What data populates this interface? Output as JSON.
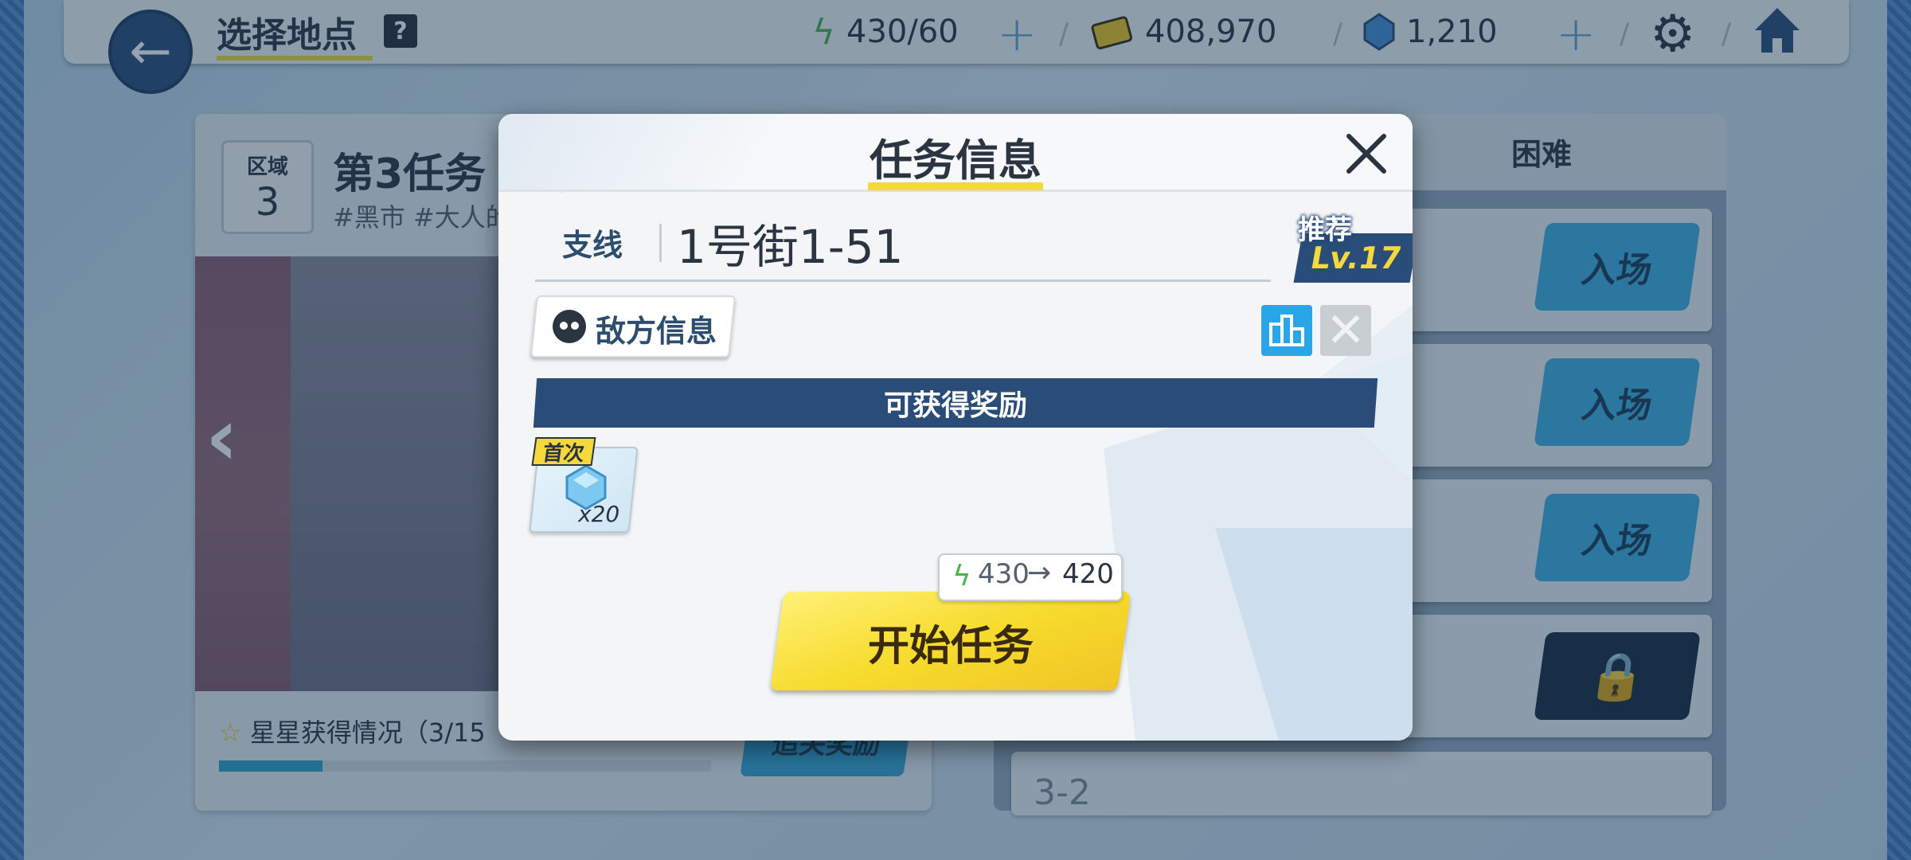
{
  "header": {
    "page_title": "选择地点",
    "help": "?",
    "ap": "430/60",
    "credits": "408,970",
    "gems": "1,210"
  },
  "left": {
    "zone_label": "区域",
    "zone_number": "3",
    "mission_title": "第3任务",
    "mission_tags": "#黑市 #大人的",
    "stars_label": "星星获得情况（3/15",
    "stars_progress": 0.21,
    "extra_reward": "追关奖励"
  },
  "right": {
    "tab_hard": "困难",
    "enter_label": "入场",
    "stage_partial": "3-2"
  },
  "modal": {
    "title": "任务信息",
    "mission_type": "支线",
    "mission_name": "1号街1-51",
    "recommend_label": "推荐",
    "recommend_level": "Lv.17",
    "enemy_info": "敌方信息",
    "reward_header": "可获得奖励",
    "first_clear_badge": "首次",
    "reward_count": "x20",
    "ap_from": "430",
    "ap_to": "420",
    "start_button": "开始任务"
  },
  "colors": {
    "navy": "#2a4c78",
    "yellow": "#f5d93c",
    "cyan": "#3fb0e0"
  },
  "icons": [
    "back-arrow-icon",
    "help-icon",
    "lightning-icon",
    "credit-card-icon",
    "gem-icon",
    "gear-icon",
    "home-icon",
    "close-icon",
    "enemy-skull-icon",
    "terrain-building-icon",
    "lock-icon"
  ]
}
